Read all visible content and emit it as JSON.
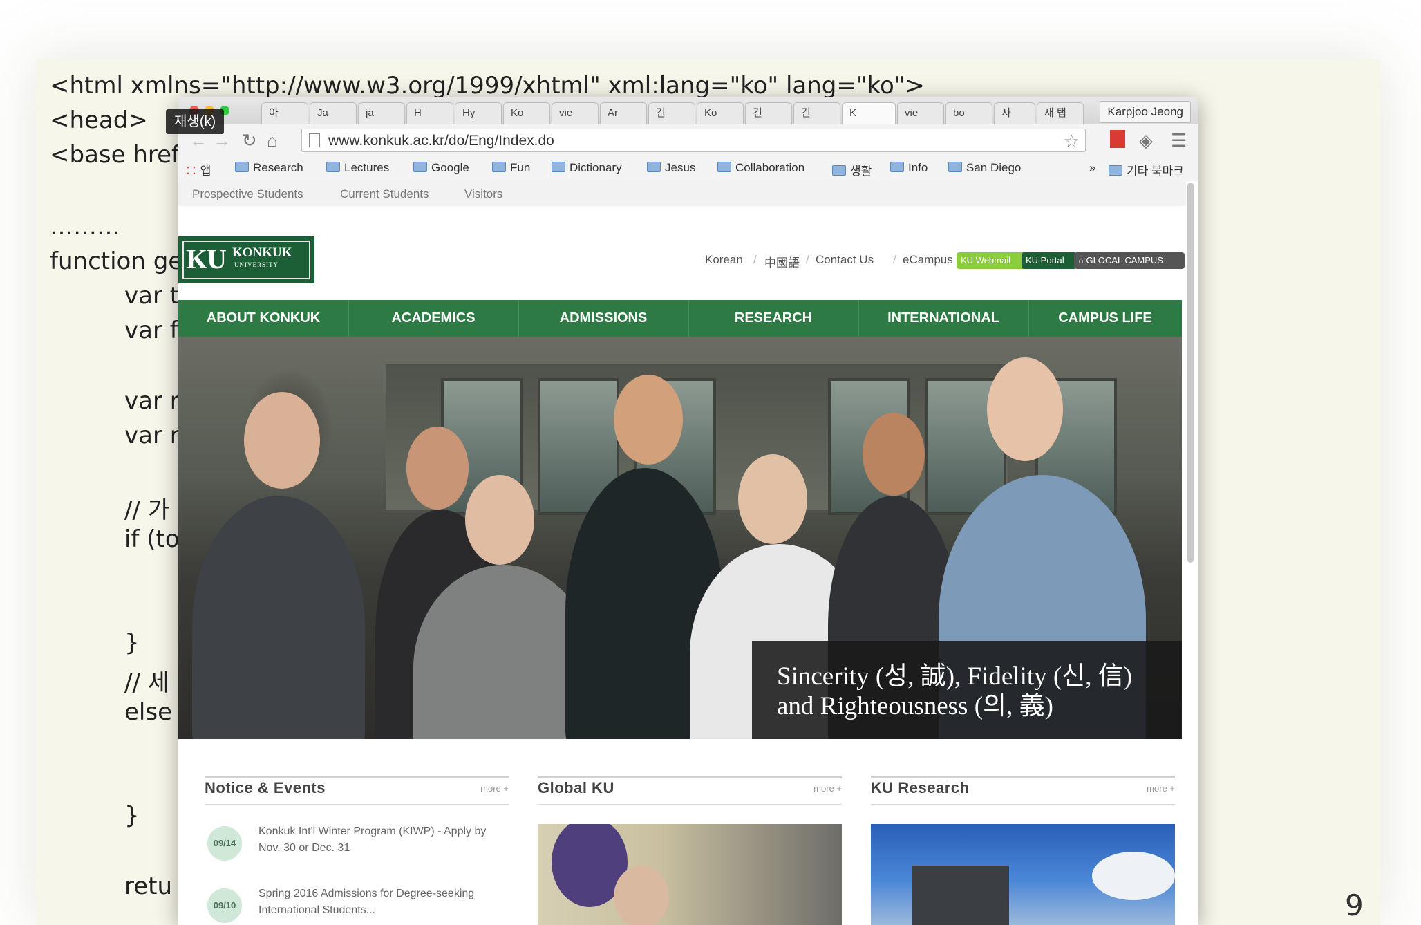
{
  "slide": {
    "code_lines": [
      "<html xmlns=\"http://www.w3.org/1999/xhtml\" xml:lang=\"ko\" lang=\"ko\">",
      "<head>",
      "<base href",
      "………",
      "function ge",
      "var t",
      "var f",
      "var r",
      "var r",
      "// 가",
      "if (to",
      "}",
      "// 세",
      "else",
      "}",
      "retu"
    ],
    "page_number": "9"
  },
  "player": {
    "play_tooltip": "재생(k)"
  },
  "browser": {
    "tabs": [
      "아",
      "Ja",
      "ja",
      "H",
      "Hy",
      "Ko",
      "vie",
      "Ar",
      "건",
      "Ko",
      "건",
      "건",
      "K",
      "vie",
      "bo",
      "자",
      "새 탭"
    ],
    "profile": "Karpjoo Jeong",
    "url": "www.konkuk.ac.kr/do/Eng/Index.do",
    "bookmarks": [
      "앱",
      "Research",
      "Lectures",
      "Google",
      "Fun",
      "Dictionary",
      "Jesus",
      "Collaboration",
      "생활",
      "Info",
      "San Diego",
      "»",
      "기타 북마크"
    ]
  },
  "site": {
    "util_links": [
      "Prospective Students",
      "Current Students",
      "Visitors"
    ],
    "logo": {
      "ku": "KU",
      "konkuk": "KONKUK",
      "university": "UNIVERSITY"
    },
    "top_links": [
      "Korean",
      "中國語",
      "Contact Us",
      "eCampus"
    ],
    "badges": [
      "KU Webmail",
      "KU Portal",
      "GLOCAL CAMPUS"
    ],
    "main_nav": [
      "ABOUT KONKUK",
      "ACADEMICS",
      "ADMISSIONS",
      "RESEARCH",
      "INTERNATIONAL",
      "CAMPUS LIFE"
    ],
    "hero_caption": "Sincerity (성, 誠), Fidelity (신, 信) and Righteousness (의, 義)",
    "sections": [
      {
        "title": "Notice & Events",
        "more": "more +"
      },
      {
        "title": "Global KU",
        "more": "more +"
      },
      {
        "title": "KU Research",
        "more": "more +"
      }
    ],
    "notices": [
      {
        "date": "09/14",
        "text": "Konkuk Int'l Winter Program (KIWP) - Apply by Nov. 30 or Dec. 31"
      },
      {
        "date": "09/10",
        "text": "Spring 2016 Admissions for Degree-seeking International Students..."
      }
    ]
  },
  "colors": {
    "brand_green": "#2d7a45",
    "logo_green": "#1c5e36",
    "slide_bg": "#f7f6ea"
  }
}
